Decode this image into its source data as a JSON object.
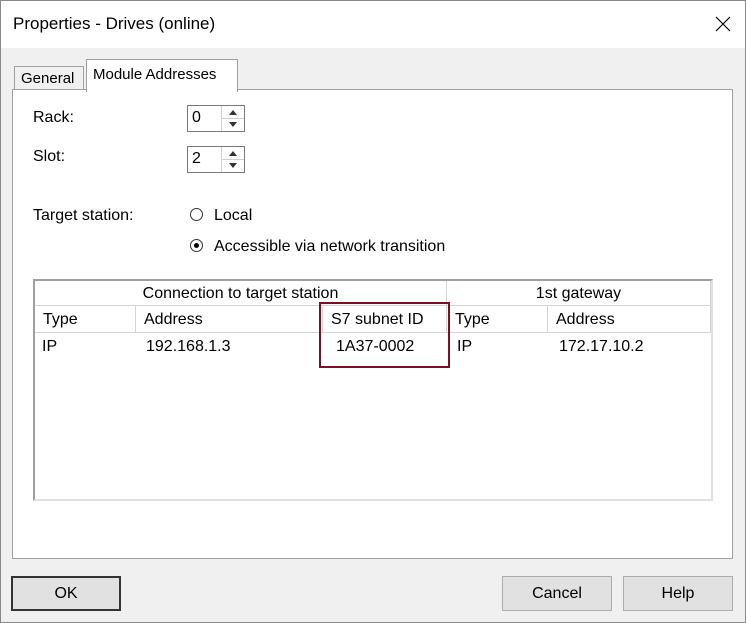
{
  "window": {
    "title": "Properties - Drives (online)"
  },
  "tabs": [
    {
      "label": "General",
      "active": false
    },
    {
      "label": "Module Addresses",
      "active": true
    }
  ],
  "fields": {
    "rack_label": "Rack:",
    "rack_value": "0",
    "slot_label": "Slot:",
    "slot_value": "2",
    "target_label": "Target station:",
    "radio_local": "Local",
    "radio_network": "Accessible via network transition",
    "selected": "Accessible via network transition"
  },
  "table": {
    "group_connection": "Connection to target station",
    "group_gateway": "1st gateway",
    "columns": [
      "Type",
      "Address",
      "S7 subnet ID",
      "Type",
      "Address"
    ],
    "rows": [
      [
        "IP",
        "192.168.1.3",
        "1A37-0002",
        "IP",
        "172.17.10.2"
      ]
    ]
  },
  "buttons": {
    "ok": "OK",
    "cancel": "Cancel",
    "help": "Help"
  },
  "colors": {
    "highlight": "#7b1020"
  }
}
